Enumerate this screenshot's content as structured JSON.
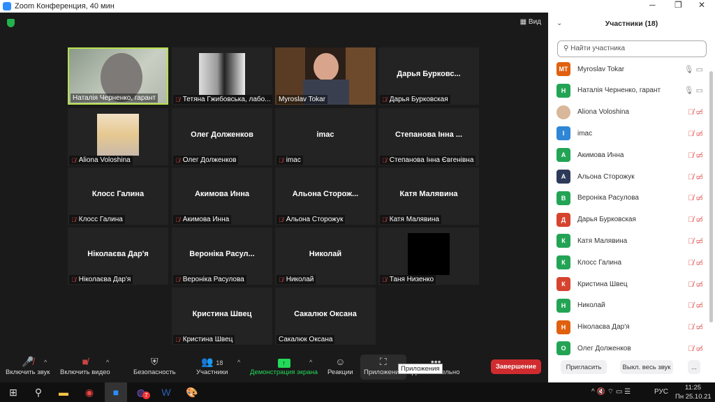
{
  "window": {
    "title": "Zoom Конференция, 40 мин"
  },
  "view_label": "Вид",
  "tiles": [
    {
      "name": "Наталія Черненко, гарант",
      "label": "Наталія Черненко, гарант",
      "kind": "video",
      "muted": false,
      "active": true
    },
    {
      "name": "",
      "label": "Тетяна Гжибовська, лабо...",
      "kind": "photo-bw",
      "muted": true
    },
    {
      "name": "",
      "label": "Myroslav Tokar",
      "kind": "video-tokar",
      "muted": false
    },
    {
      "name": "Дарья  Бурковс...",
      "label": "Дарья Бурковская",
      "kind": "name",
      "muted": true
    },
    {
      "name": "",
      "label": "Aliona Voloshina",
      "kind": "photo",
      "muted": true
    },
    {
      "name": "Олег Долженков",
      "label": "Олег Долженков",
      "kind": "name",
      "muted": true
    },
    {
      "name": "imac",
      "label": "imac",
      "kind": "name",
      "muted": true
    },
    {
      "name": "Степанова Інна ...",
      "label": "Степанова Інна Євгенівна",
      "kind": "name",
      "muted": true
    },
    {
      "name": "Клосс Галина",
      "label": "Клосс Галина",
      "kind": "name",
      "muted": true
    },
    {
      "name": "Акимова Инна",
      "label": "Акимова Инна",
      "kind": "name",
      "muted": true
    },
    {
      "name": "Альона  Сторож...",
      "label": "Альона Сторожук",
      "kind": "name",
      "muted": true
    },
    {
      "name": "Катя Малявина",
      "label": "Катя Малявина",
      "kind": "name",
      "muted": true
    },
    {
      "name": "Ніколаєва Дар'я",
      "label": "Ніколаєва Дар'я",
      "kind": "name",
      "muted": true
    },
    {
      "name": "Вероніка  Расул...",
      "label": "Вероніка Расулова",
      "kind": "name",
      "muted": true
    },
    {
      "name": "Николай",
      "label": "Николай",
      "kind": "name",
      "muted": true
    },
    {
      "name": "",
      "label": "Таня Низенко",
      "kind": "black",
      "muted": true
    },
    {
      "name": "Кристина Швец",
      "label": "Кристина Швец",
      "kind": "name",
      "muted": true
    },
    {
      "name": "Сакалюк Оксана",
      "label": "Сакалюк Оксана",
      "kind": "name",
      "muted": false
    }
  ],
  "toolbar": {
    "unmute": "Включить звук",
    "video": "Включить видео",
    "security": "Безопасность",
    "participants": "Участники",
    "participants_count": "18",
    "share": "Демонстрация экрана",
    "reactions": "Реакции",
    "apps": "Приложения",
    "more": "Дополнительно",
    "end": "Завершение",
    "tooltip": "Приложения",
    "share_color": "#23d959",
    "end_color": "#d02c2f"
  },
  "panel": {
    "title": "Участники (18)",
    "search_placeholder": "Найти участника",
    "invite": "Пригласить",
    "mute_all": "Выкл. весь звук",
    "more": "...",
    "participants": [
      {
        "initials": "MT",
        "name": "Myroslav Tokar",
        "color": "#e0600f",
        "audio": "on",
        "video": "off-plain"
      },
      {
        "initials": "Н",
        "name": "Наталія Черненко, гарант",
        "color": "#23a455",
        "audio": "on",
        "video": "off-plain"
      },
      {
        "initials": "",
        "name": "Aliona Voloshina",
        "color": "#d9b79a",
        "audio": "muted",
        "video": "off"
      },
      {
        "initials": "I",
        "name": "imac",
        "color": "#2f86d6",
        "audio": "muted",
        "video": "off"
      },
      {
        "initials": "А",
        "name": "Акимова Инна",
        "color": "#23a455",
        "audio": "muted",
        "video": "off"
      },
      {
        "initials": "А",
        "name": "Альона Сторожук",
        "color": "#2d3a5a",
        "audio": "muted",
        "video": "off"
      },
      {
        "initials": "В",
        "name": "Вероніка Расулова",
        "color": "#23a455",
        "audio": "muted",
        "video": "off"
      },
      {
        "initials": "Д",
        "name": "Дарья Бурковская",
        "color": "#d6432f",
        "audio": "muted",
        "video": "off"
      },
      {
        "initials": "К",
        "name": "Катя Малявина",
        "color": "#23a455",
        "audio": "muted",
        "video": "off"
      },
      {
        "initials": "К",
        "name": "Клосс Галина",
        "color": "#23a455",
        "audio": "muted",
        "video": "off"
      },
      {
        "initials": "К",
        "name": "Кристина Швец",
        "color": "#d6432f",
        "audio": "muted",
        "video": "off"
      },
      {
        "initials": "Н",
        "name": "Николай",
        "color": "#23a455",
        "audio": "muted",
        "video": "off"
      },
      {
        "initials": "Н",
        "name": "Ніколаєва Дар'я",
        "color": "#e0600f",
        "audio": "muted",
        "video": "off"
      },
      {
        "initials": "О",
        "name": "Олег Долженков",
        "color": "#23a455",
        "audio": "muted",
        "video": "off"
      }
    ]
  },
  "taskbar": {
    "lang": "РУС",
    "time": "11:25",
    "date": "Пн 25.10.21",
    "viber_badge": "7"
  }
}
